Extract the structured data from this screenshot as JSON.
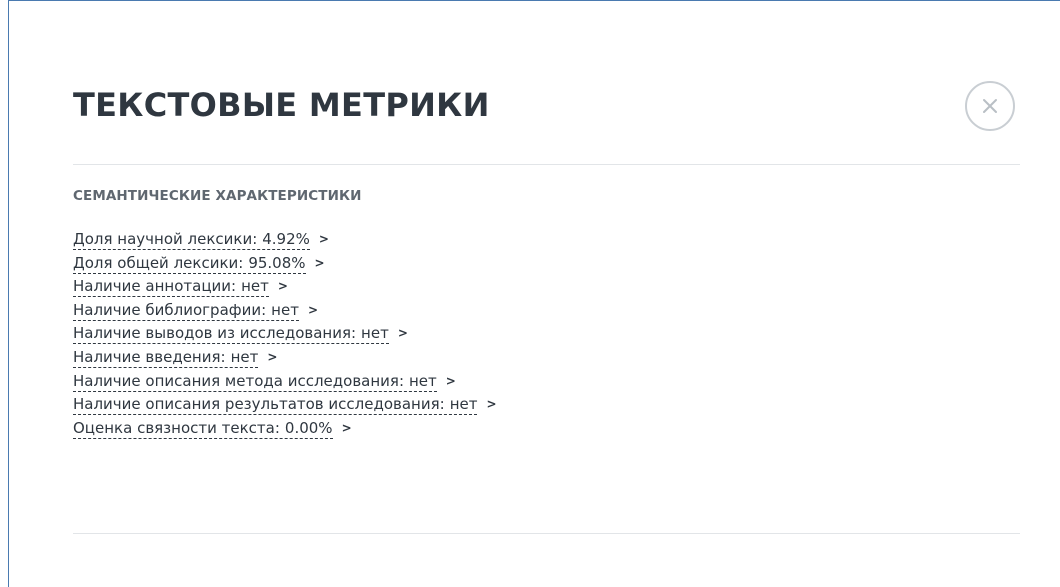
{
  "modal": {
    "title": "ТЕКСТОВЫЕ МЕТРИКИ",
    "close_icon": "close-circle-icon",
    "section_title": "СЕМАНТИЧЕСКИЕ ХАРАКТЕРИСТИКИ",
    "metrics": [
      {
        "label": "Доля научной лексики:",
        "value": "4.92%"
      },
      {
        "label": "Доля общей лексики:",
        "value": "95.08%"
      },
      {
        "label": "Наличие аннотации:",
        "value": "нет"
      },
      {
        "label": "Наличие библиографии:",
        "value": "нет"
      },
      {
        "label": "Наличие выводов из исследования:",
        "value": "нет"
      },
      {
        "label": "Наличие введения:",
        "value": "нет"
      },
      {
        "label": "Наличие описания метода исследования:",
        "value": "нет"
      },
      {
        "label": "Наличие описания результатов исследования:",
        "value": "нет"
      },
      {
        "label": "Оценка связности текста:",
        "value": "0.00%"
      }
    ],
    "chevron_icon": "chevron-right-icon"
  },
  "colors": {
    "title": "#2f3740",
    "section_title": "#5f6770",
    "divider": "#e2e5e8",
    "close_icon": "#b9bfc5",
    "window_border": "#4a7ab0"
  }
}
